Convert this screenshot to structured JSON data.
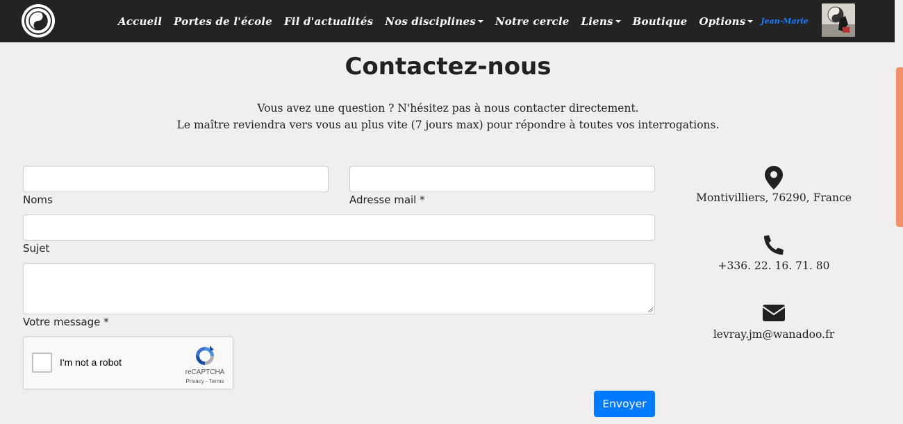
{
  "navbar": {
    "items": [
      {
        "label": "Accueil",
        "dropdown": false
      },
      {
        "label": "Portes de l'école",
        "dropdown": false
      },
      {
        "label": "Fil d'actualités",
        "dropdown": false
      },
      {
        "label": "Nos disciplines",
        "dropdown": true
      },
      {
        "label": "Notre cercle",
        "dropdown": false
      },
      {
        "label": "Liens",
        "dropdown": true
      },
      {
        "label": "Boutique",
        "dropdown": false
      },
      {
        "label": "Options",
        "dropdown": true
      }
    ],
    "user_name": "Jean-Marie"
  },
  "page": {
    "title": "Contactez-nous",
    "intro_line1": "Vous avez une question ? N'hésitez pas à nous contacter directement.",
    "intro_line2": "Le maître reviendra vers vous au plus vite (7 jours max) pour répondre à toutes vos interrogations."
  },
  "form": {
    "name_label": "Noms",
    "name_value": "",
    "email_label": "Adresse mail *",
    "email_value": "",
    "subject_label": "Sujet",
    "subject_value": "",
    "message_label": "Votre message *",
    "message_value": "",
    "send_label": "Envoyer"
  },
  "captcha": {
    "label": "I'm not a robot",
    "brand": "reCAPTCHA",
    "links": "Privacy - Terms"
  },
  "contact": {
    "address": "Montivilliers, 76290, France",
    "phone": "+336. 22. 16. 71. 80",
    "email": "levray.jm@wanadoo.fr"
  },
  "colors": {
    "navbar_bg": "#232323",
    "accent": "#007bff",
    "user_name": "#1f7bff",
    "page_bg": "#f0efed",
    "scroll_thumb": "#f0916a"
  },
  "icons": [
    "logo-icon",
    "map-marker-icon",
    "phone-icon",
    "envelope-icon",
    "recaptcha-icon"
  ]
}
